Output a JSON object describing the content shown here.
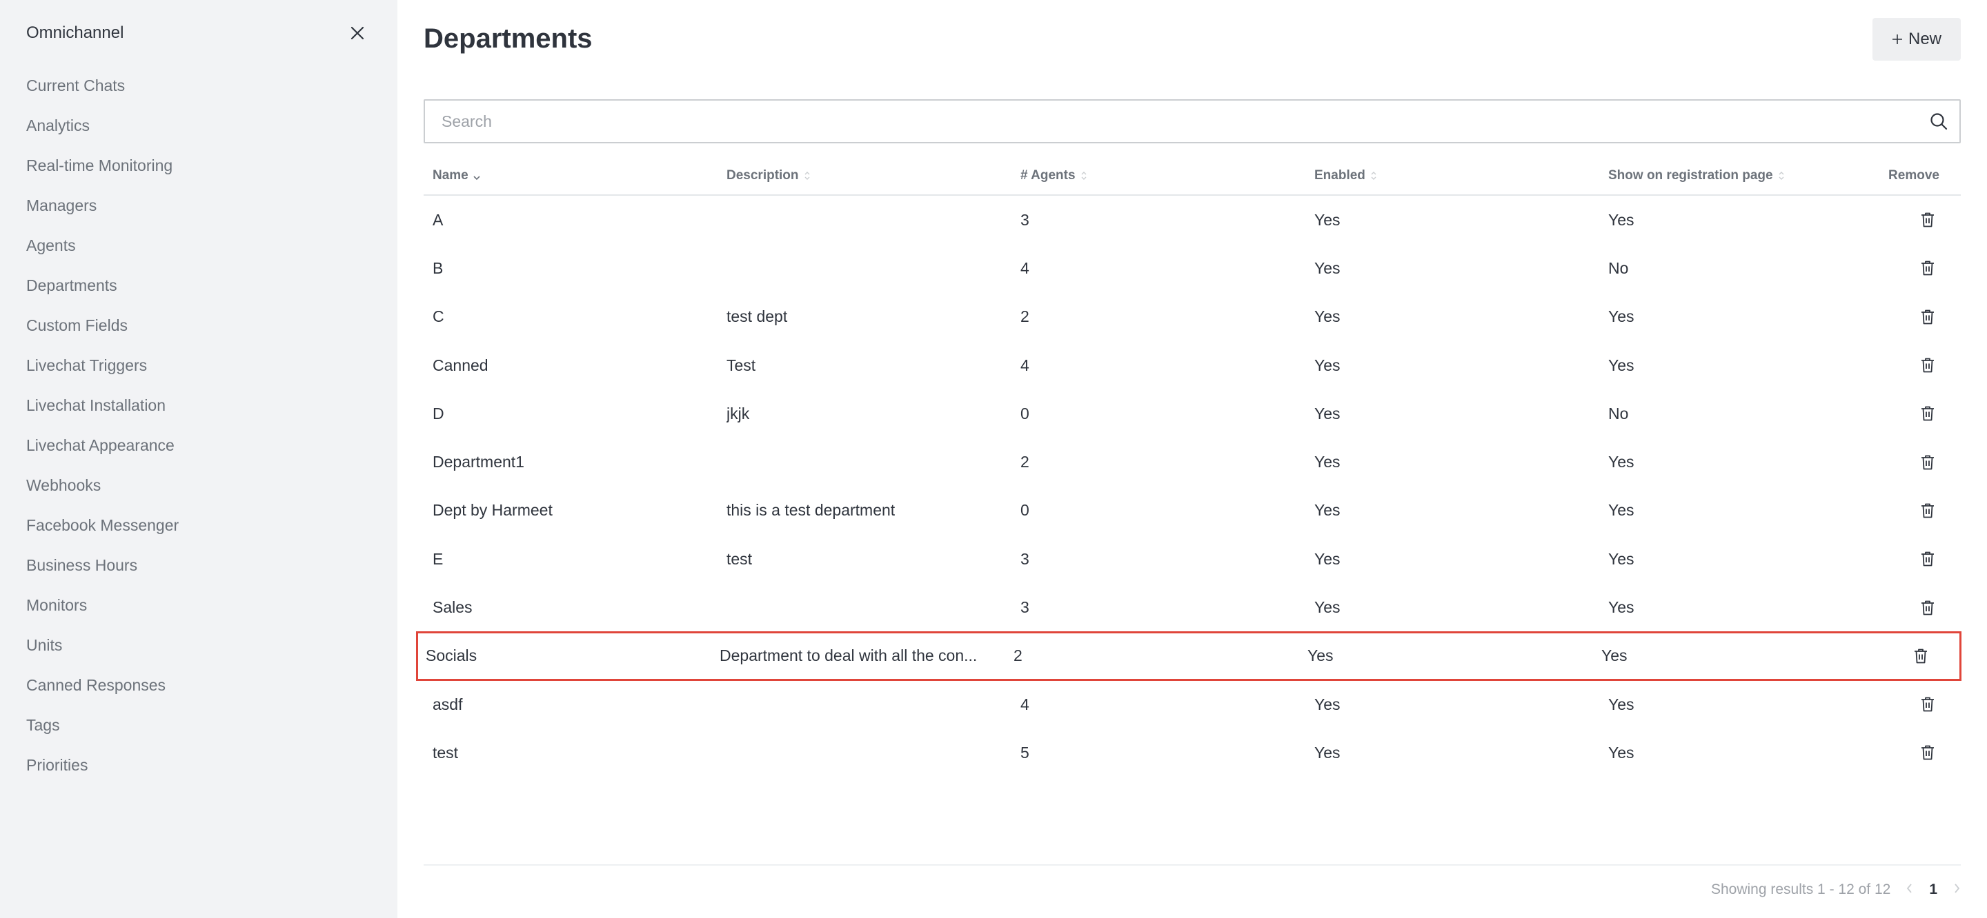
{
  "sidebar": {
    "title": "Omnichannel",
    "items": [
      {
        "label": "Current Chats"
      },
      {
        "label": "Analytics"
      },
      {
        "label": "Real-time Monitoring"
      },
      {
        "label": "Managers"
      },
      {
        "label": "Agents"
      },
      {
        "label": "Departments"
      },
      {
        "label": "Custom Fields"
      },
      {
        "label": "Livechat Triggers"
      },
      {
        "label": "Livechat Installation"
      },
      {
        "label": "Livechat Appearance"
      },
      {
        "label": "Webhooks"
      },
      {
        "label": "Facebook Messenger"
      },
      {
        "label": "Business Hours"
      },
      {
        "label": "Monitors"
      },
      {
        "label": "Units"
      },
      {
        "label": "Canned Responses"
      },
      {
        "label": "Tags"
      },
      {
        "label": "Priorities"
      }
    ]
  },
  "header": {
    "title": "Departments",
    "new_label": "New"
  },
  "search": {
    "placeholder": "Search",
    "value": ""
  },
  "table": {
    "columns": [
      "Name",
      "Description",
      "# Agents",
      "Enabled",
      "Show on registration page",
      "Remove"
    ],
    "rows": [
      {
        "name": "A",
        "description": "",
        "agents": "3",
        "enabled": "Yes",
        "show": "Yes"
      },
      {
        "name": "B",
        "description": "",
        "agents": "4",
        "enabled": "Yes",
        "show": "No"
      },
      {
        "name": "C",
        "description": "test dept",
        "agents": "2",
        "enabled": "Yes",
        "show": "Yes"
      },
      {
        "name": "Canned",
        "description": "Test",
        "agents": "4",
        "enabled": "Yes",
        "show": "Yes"
      },
      {
        "name": "D",
        "description": "jkjk",
        "agents": "0",
        "enabled": "Yes",
        "show": "No"
      },
      {
        "name": "Department1",
        "description": "",
        "agents": "2",
        "enabled": "Yes",
        "show": "Yes"
      },
      {
        "name": "Dept by Harmeet",
        "description": "this is a test department",
        "agents": "0",
        "enabled": "Yes",
        "show": "Yes"
      },
      {
        "name": "E",
        "description": "test",
        "agents": "3",
        "enabled": "Yes",
        "show": "Yes"
      },
      {
        "name": "Sales",
        "description": "",
        "agents": "3",
        "enabled": "Yes",
        "show": "Yes"
      },
      {
        "name": "Socials",
        "description": "Department to deal with all the con...",
        "agents": "2",
        "enabled": "Yes",
        "show": "Yes",
        "highlighted": true
      },
      {
        "name": "asdf",
        "description": "",
        "agents": "4",
        "enabled": "Yes",
        "show": "Yes"
      },
      {
        "name": "test",
        "description": "",
        "agents": "5",
        "enabled": "Yes",
        "show": "Yes"
      }
    ]
  },
  "pagination": {
    "summary": "Showing results 1 - 12 of 12",
    "current_page": "1"
  },
  "colors": {
    "highlight_border": "#e0453a",
    "sidebar_bg": "#f2f3f5",
    "button_bg": "#eeeff1"
  }
}
